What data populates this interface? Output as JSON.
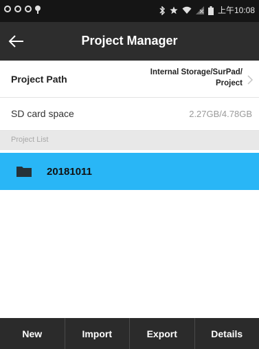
{
  "status_bar": {
    "time": "上午10:08",
    "icons": [
      "circle-icon",
      "circle-icon",
      "circle-icon",
      "location-pin-icon",
      "bluetooth-icon",
      "star-icon",
      "wifi-icon",
      "no-signal-icon",
      "battery-icon"
    ]
  },
  "header": {
    "title": "Project Manager",
    "back_icon": "arrow-left-icon"
  },
  "settings": {
    "project_path_label": "Project Path",
    "project_path_value_line1": "Internal Storage/SurPad/",
    "project_path_value_line2": "Project",
    "sd_card_label": "SD card space",
    "sd_card_value": "2.27GB/4.78GB"
  },
  "project_list": {
    "header": "Project List",
    "items": [
      {
        "name": "20181011",
        "icon": "folder-icon",
        "selected": true
      }
    ]
  },
  "bottom_bar": {
    "new_label": "New",
    "import_label": "Import",
    "export_label": "Export",
    "details_label": "Details"
  },
  "colors": {
    "status_bar": "#151515",
    "app_bar": "#2d2d2d",
    "selected_item": "#29b6f6",
    "section_header": "#e8e8e8",
    "bottom_bar": "#2b2b2b"
  }
}
